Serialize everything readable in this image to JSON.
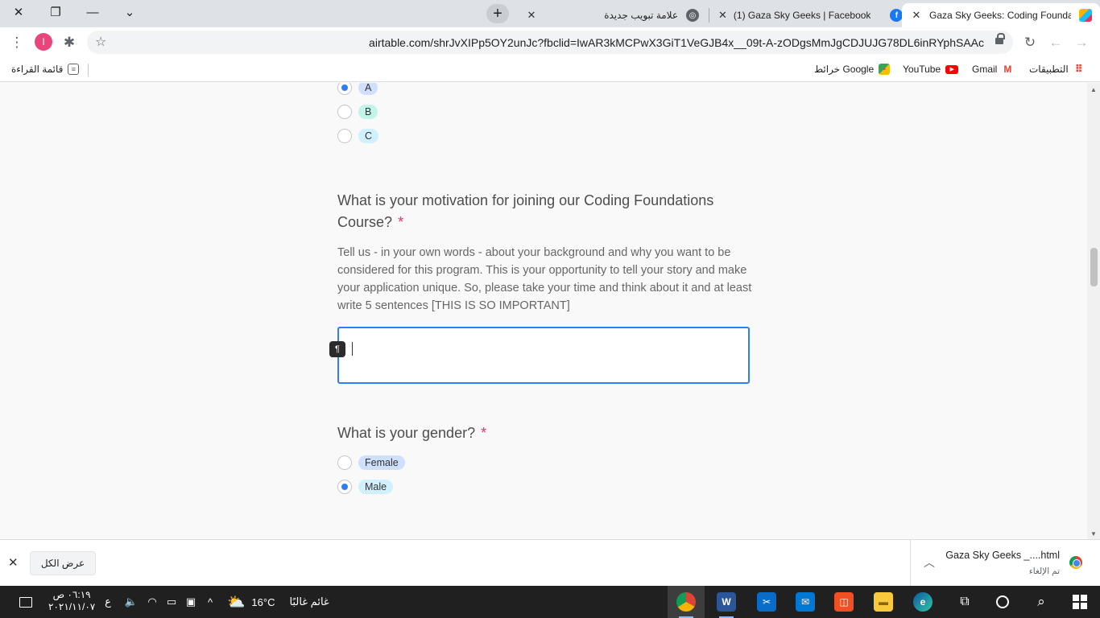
{
  "browser": {
    "tabs": [
      {
        "title": "Gaza Sky Geeks: Coding Foundat",
        "icon": "airtable-icon",
        "active": true
      },
      {
        "title": "(1) Gaza Sky Geeks | Facebook",
        "icon": "facebook-icon",
        "active": false
      },
      {
        "title": "علامة تبويب جديدة",
        "icon": "chrome-icon",
        "active": false
      }
    ],
    "new_tab_label": "+",
    "url": "airtable.com/shrJvXIPp5OY2unJc?fbclid=IwAR3kMCPwX3GiT1VeGJB4x__09t-A-zODgsMmJgCDJUJG78DL6inRYphSAAc",
    "profile_initial": "I"
  },
  "bookmarks": {
    "apps_label": "التطبيقات",
    "items": [
      {
        "label": "Gmail",
        "icon": "gmail-icon"
      },
      {
        "label": "YouTube",
        "icon": "youtube-icon"
      },
      {
        "label": "خرائط Google",
        "icon": "maps-icon"
      }
    ],
    "reading_list": "قائمة القراءة"
  },
  "form": {
    "prev_options": [
      {
        "label": "A",
        "checked": true,
        "color": "#cfdfff"
      },
      {
        "label": "B",
        "checked": false,
        "color": "#c2f5e9"
      },
      {
        "label": "C",
        "checked": false,
        "color": "#d0f0fd"
      }
    ],
    "motivation": {
      "question": "What is your motivation for joining our Coding Foundations Course?",
      "required_mark": "*",
      "description": "Tell us - in your own words - about your background and why you want to be considered for this program. This is your opportunity to tell your story and make your application unique. So, please take your time and think about it and at least write 5 sentences [THIS IS SO IMPORTANT]",
      "value": "",
      "badge": "¶"
    },
    "gender": {
      "question": "What is your gender?",
      "required_mark": "*",
      "options": [
        {
          "label": "Female",
          "checked": false,
          "color": "#cfdfff"
        },
        {
          "label": "Male",
          "checked": true,
          "color": "#d0f0fd"
        }
      ]
    }
  },
  "downloads": {
    "show_all": "عرض الكل",
    "file_name": "Gaza Sky Geeks _....html",
    "status": "تم الإلغاء"
  },
  "taskbar": {
    "time": "٠٦:١٩ ص",
    "date": "٢٠٢١/١١/٠٧",
    "lang": "ع",
    "weather_temp": "16°C",
    "weather_desc": "غائم غالبًا"
  }
}
